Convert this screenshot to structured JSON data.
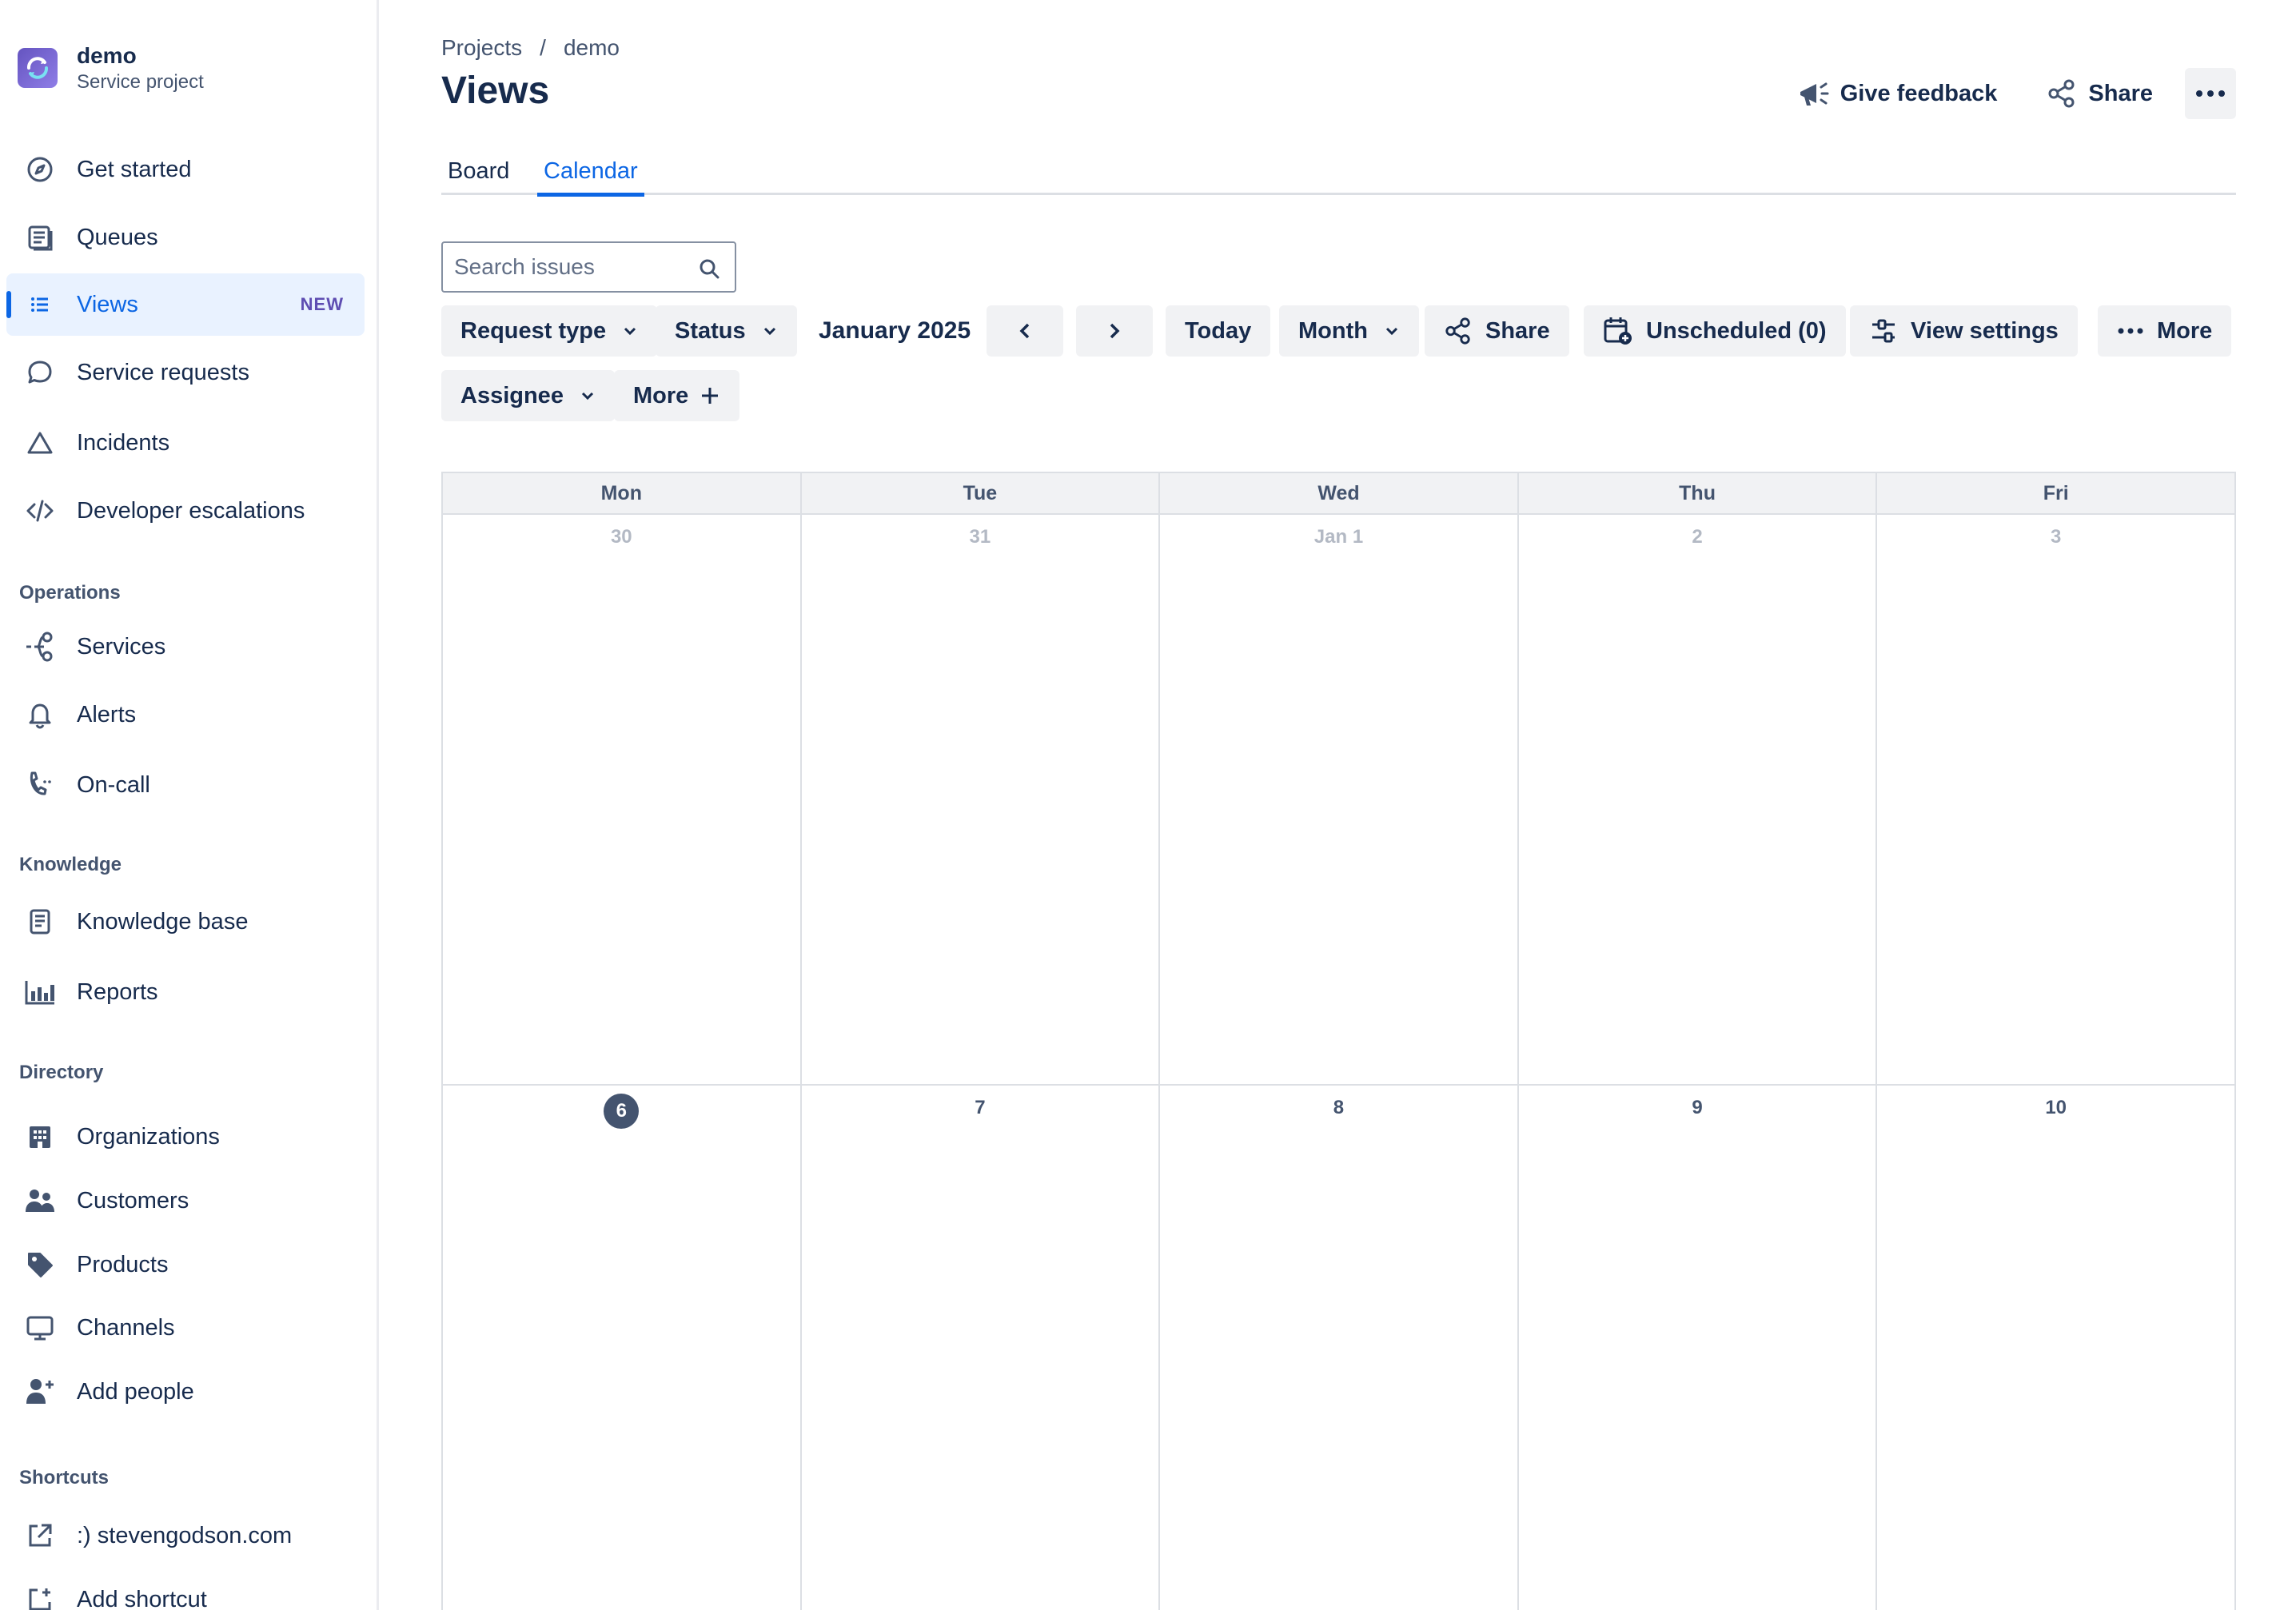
{
  "project": {
    "name": "demo",
    "type": "Service project"
  },
  "nav": {
    "get_started": "Get started",
    "queues": "Queues",
    "views": "Views",
    "views_badge": "NEW",
    "service_requests": "Service requests",
    "incidents": "Incidents",
    "developer_escalations": "Developer escalations"
  },
  "sections": {
    "operations": "Operations",
    "knowledge": "Knowledge",
    "directory": "Directory",
    "shortcuts": "Shortcuts"
  },
  "operations": {
    "services": "Services",
    "alerts": "Alerts",
    "on_call": "On-call"
  },
  "knowledge": {
    "knowledge_base": "Knowledge base",
    "reports": "Reports"
  },
  "directory": {
    "organizations": "Organizations",
    "customers": "Customers",
    "products": "Products",
    "channels": "Channels",
    "add_people": "Add people"
  },
  "shortcuts": {
    "site": ":) stevengodson.com",
    "add_shortcut": "Add shortcut"
  },
  "breadcrumb": {
    "root": "Projects",
    "separator": "/",
    "current": "demo"
  },
  "page_title": "Views",
  "header": {
    "feedback": "Give feedback",
    "share": "Share"
  },
  "tabs": {
    "board": "Board",
    "calendar": "Calendar"
  },
  "search": {
    "placeholder": "Search issues"
  },
  "toolbar": {
    "request_type": "Request type",
    "status": "Status",
    "month_label": "January 2025",
    "today": "Today",
    "month": "Month",
    "share": "Share",
    "unscheduled": "Unscheduled (0)",
    "view_settings": "View settings",
    "more": "More",
    "assignee": "Assignee",
    "more_filters": "More"
  },
  "calendar": {
    "days": [
      "Mon",
      "Tue",
      "Wed",
      "Thu",
      "Fri"
    ],
    "week1": [
      "30",
      "31",
      "Jan 1",
      "2",
      "3"
    ],
    "week2": [
      "6",
      "7",
      "8",
      "9",
      "10"
    ]
  }
}
